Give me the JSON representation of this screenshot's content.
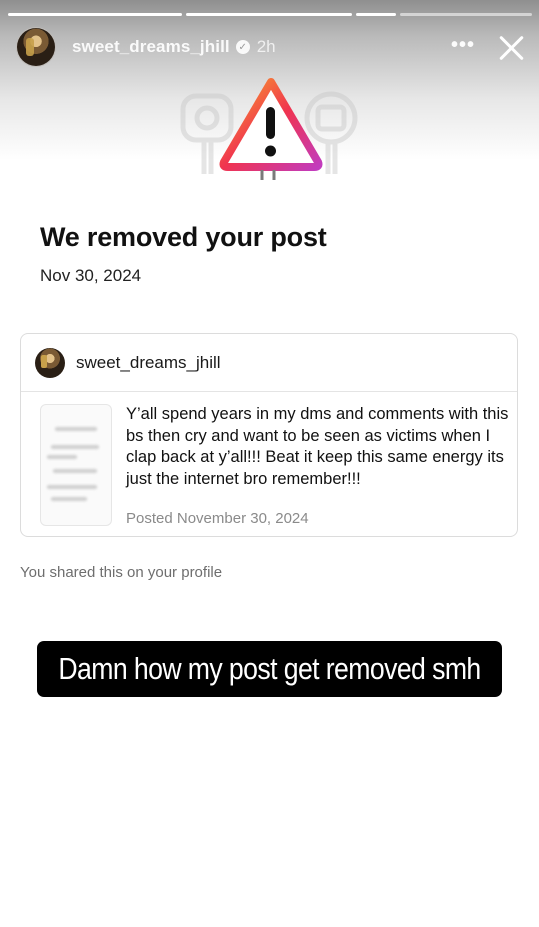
{
  "story": {
    "username": "sweet_dreams_jhill",
    "time": "2h",
    "more_label": "•••",
    "icons": {
      "verified": "verified-badge-icon",
      "more": "more-options-icon",
      "close": "close-icon",
      "warning": "warning-triangle-icon"
    }
  },
  "removal": {
    "title": "We removed your post",
    "date": "Nov 30, 2024"
  },
  "post": {
    "username": "sweet_dreams_jhill",
    "text": "Y’all spend years in my dms and comments with this bs then cry and want to be seen as victims when I clap back at y’all!!! Beat it keep this same energy its just the internet bro remember!!!",
    "posted": "Posted November 30, 2024"
  },
  "shared_note": "You shared this on your profile",
  "caption": "Damn how my post get removed smh",
  "colors": {
    "caption_bg": "#000000",
    "warning_gradient": [
      "#f9a52b",
      "#f0344f",
      "#c23bbd"
    ]
  }
}
